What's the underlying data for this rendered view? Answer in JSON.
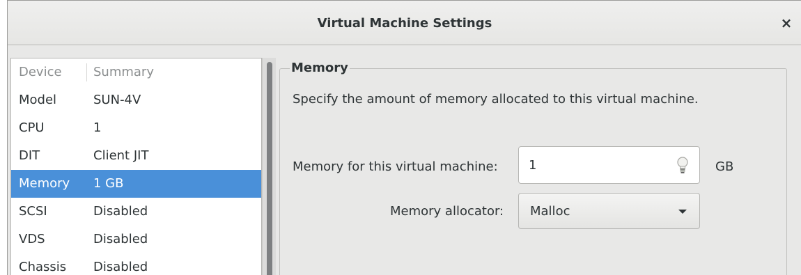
{
  "window": {
    "title": "Virtual Machine Settings",
    "close_label": "×"
  },
  "device_list": {
    "headers": {
      "device": "Device",
      "summary": "Summary"
    },
    "rows": [
      {
        "device": "Model",
        "summary": "SUN-4V"
      },
      {
        "device": "CPU",
        "summary": "1"
      },
      {
        "device": "DIT",
        "summary": "Client JIT"
      },
      {
        "device": "Memory",
        "summary": "1 GB",
        "selected": true
      },
      {
        "device": "SCSI",
        "summary": "Disabled"
      },
      {
        "device": "VDS",
        "summary": "Disabled"
      },
      {
        "device": "Chassis",
        "summary": "Disabled"
      }
    ]
  },
  "memory_panel": {
    "frame_label": "Memory",
    "description": "Specify the amount of memory allocated to this virtual machine.",
    "memory_label": "Memory for this virtual machine:",
    "memory_value": "1",
    "memory_unit": "GB",
    "allocator_label": "Memory allocator:",
    "allocator_value": "Malloc"
  },
  "colors": {
    "selection": "#4a90d9",
    "window_bg": "#e8e8e7"
  }
}
